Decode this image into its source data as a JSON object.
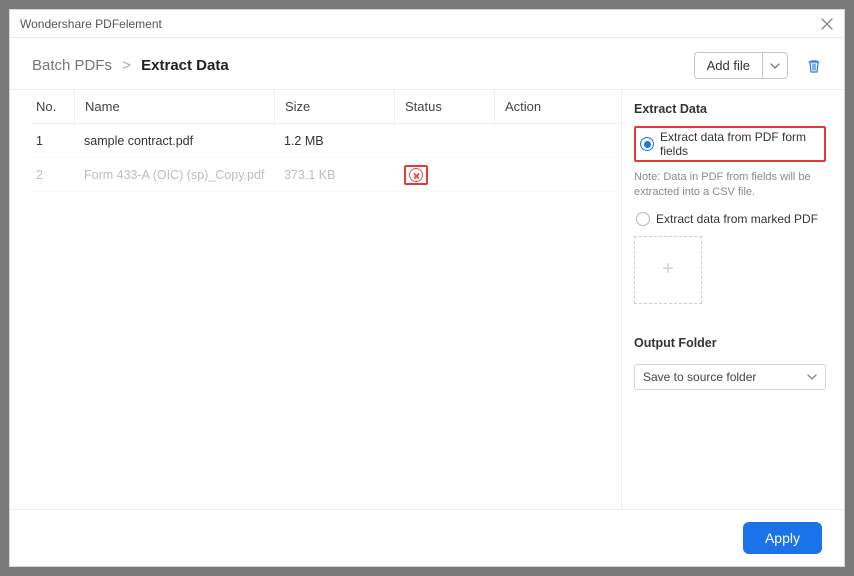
{
  "window_title": "Wondershare PDFelement",
  "breadcrumb": {
    "root": "Batch PDFs",
    "sep": ">",
    "leaf": "Extract Data"
  },
  "toolbar": {
    "add_file_label": "Add file"
  },
  "table": {
    "columns": {
      "no": "No.",
      "name": "Name",
      "size": "Size",
      "status": "Status",
      "action": "Action"
    },
    "rows": [
      {
        "no": "1",
        "name": "sample contract.pdf",
        "size": "1.2 MB",
        "status": "",
        "faded": false
      },
      {
        "no": "2",
        "name": "Form 433-A (OIC) (sp)_Copy.pdf",
        "size": "373.1 KB",
        "status": "",
        "faded": true,
        "show_delete": true
      }
    ]
  },
  "right": {
    "title": "Extract Data",
    "opt_form_fields": "Extract data from PDF form fields",
    "note": "Note: Data in PDF from fields will be extracted into a CSV file.",
    "opt_marked": "Extract data from marked PDF",
    "output_folder_label": "Output Folder",
    "output_folder_value": "Save to source folder"
  },
  "footer": {
    "apply": "Apply"
  }
}
